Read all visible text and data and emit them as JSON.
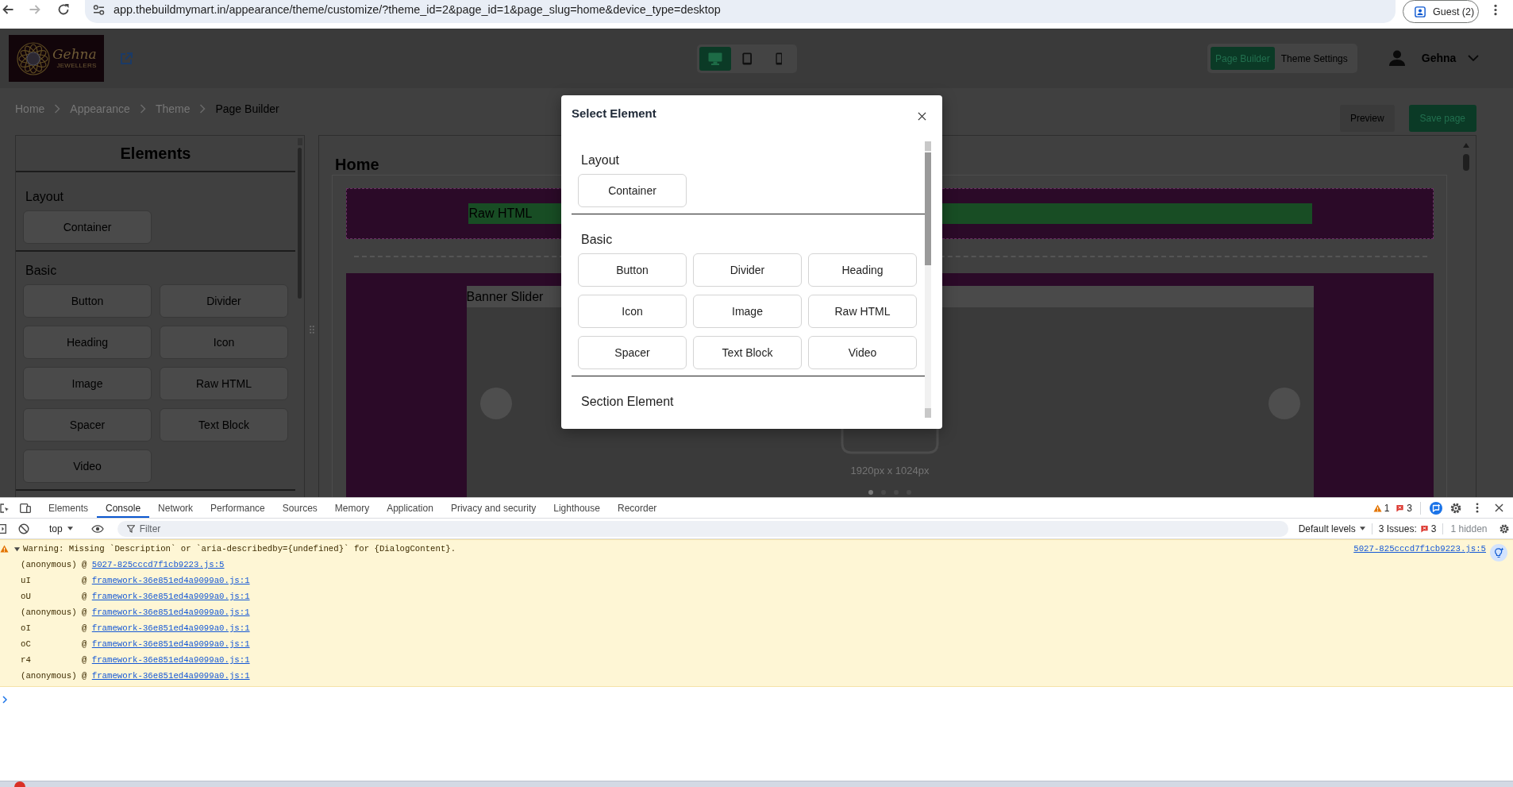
{
  "browser": {
    "url": "app.thebuildmymart.in/appearance/theme/customize/?theme_id=2&page_id=1&page_slug=home&device_type=desktop",
    "profile": "Guest (2)"
  },
  "header": {
    "logo": {
      "name": "Gehna",
      "tagline": "JEWELLERS"
    },
    "devices": [
      {
        "kind": "desktop",
        "selected": true
      },
      {
        "kind": "tablet",
        "selected": false
      },
      {
        "kind": "mobile",
        "selected": false
      }
    ],
    "modes": [
      {
        "label": "Page Builder",
        "selected": true
      },
      {
        "label": "Theme Settings",
        "selected": false
      }
    ],
    "user": "Gehna"
  },
  "breadcrumbs": [
    {
      "label": "Home",
      "current": false
    },
    {
      "label": "Appearance",
      "current": false
    },
    {
      "label": "Theme",
      "current": false
    },
    {
      "label": "Page Builder",
      "current": true
    }
  ],
  "actions": [
    {
      "label": "Preview",
      "kind": "secondary"
    },
    {
      "label": "Save page",
      "kind": "primary"
    }
  ],
  "elements_panel": {
    "title": "Elements",
    "groups": [
      {
        "title": "Layout",
        "items": [
          "Container"
        ]
      },
      {
        "title": "Basic",
        "items": [
          "Button",
          "Divider",
          "Heading",
          "Icon",
          "Image",
          "Raw HTML",
          "Spacer",
          "Text Block",
          "Video"
        ]
      }
    ]
  },
  "canvas": {
    "title": "Home",
    "blocks": [
      {
        "kind": "raw_html",
        "label": "Raw HTML"
      },
      {
        "kind": "banner_slider",
        "label": "Banner Slider",
        "caption": "1920px x 1024px",
        "slides": [
          {
            "selected": true
          },
          {
            "selected": false
          },
          {
            "selected": false
          },
          {
            "selected": false
          }
        ]
      }
    ]
  },
  "dialog": {
    "title": "Select Element",
    "groups": [
      {
        "title": "Layout",
        "items": [
          "Container"
        ]
      },
      {
        "title": "Basic",
        "items": [
          "Button",
          "Divider",
          "Heading",
          "Icon",
          "Image",
          "Raw HTML",
          "Spacer",
          "Text Block",
          "Video"
        ]
      },
      {
        "title": "Section Element"
      }
    ]
  },
  "devtools": {
    "tabs": [
      {
        "label": "Elements",
        "selected": false
      },
      {
        "label": "Console",
        "selected": true
      },
      {
        "label": "Network",
        "selected": false
      },
      {
        "label": "Performance",
        "selected": false
      },
      {
        "label": "Sources",
        "selected": false
      },
      {
        "label": "Memory",
        "selected": false
      },
      {
        "label": "Application",
        "selected": false
      },
      {
        "label": "Privacy and security",
        "selected": false
      },
      {
        "label": "Lighthouse",
        "selected": false
      },
      {
        "label": "Recorder",
        "selected": false
      }
    ],
    "warnings": "1",
    "errors": "3",
    "context": "top",
    "filter_placeholder": "Filter",
    "levels": "Default levels",
    "issues_label": "3 Issues:",
    "issues_count": "3",
    "hidden": "1 hidden",
    "messages": [
      {
        "kind": "warning",
        "expanded": true,
        "text": "Warning: Missing `Description` or `aria-describedby={undefined}` for {DialogContent}.",
        "source": "5027-825cccd7f1cb9223.js:5",
        "frames": [
          {
            "function": "(anonymous)",
            "at": "@",
            "link": "5027-825cccd7f1cb9223.js:5"
          },
          {
            "function": "uI",
            "at": "@",
            "link": "framework-36e851ed4a9099a0.js:1"
          },
          {
            "function": "oU",
            "at": "@",
            "link": "framework-36e851ed4a9099a0.js:1"
          },
          {
            "function": "(anonymous)",
            "at": "@",
            "link": "framework-36e851ed4a9099a0.js:1"
          },
          {
            "function": "oI",
            "at": "@",
            "link": "framework-36e851ed4a9099a0.js:1"
          },
          {
            "function": "oC",
            "at": "@",
            "link": "framework-36e851ed4a9099a0.js:1"
          },
          {
            "function": "r4",
            "at": "@",
            "link": "framework-36e851ed4a9099a0.js:1"
          },
          {
            "function": "(anonymous)",
            "at": "@",
            "link": "framework-36e851ed4a9099a0.js:1"
          }
        ]
      }
    ]
  }
}
